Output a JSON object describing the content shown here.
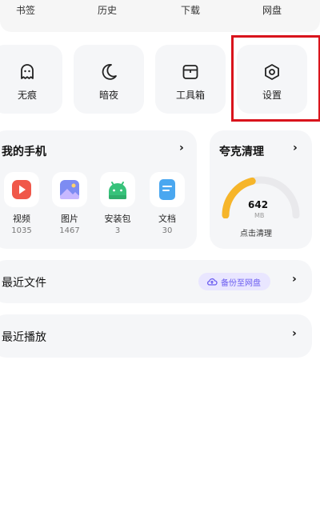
{
  "top_tabs": [
    "书签",
    "历史",
    "下载",
    "网盘"
  ],
  "quick_actions": [
    {
      "label": "无痕",
      "icon": "incognito-icon"
    },
    {
      "label": "暗夜",
      "icon": "moon-icon"
    },
    {
      "label": "工具箱",
      "icon": "toolbox-icon"
    },
    {
      "label": "设置",
      "icon": "gear-icon"
    }
  ],
  "my_phone": {
    "title": "我的手机",
    "items": [
      {
        "name": "视频",
        "count": "1035",
        "icon": "video-icon",
        "color": "#f0584a"
      },
      {
        "name": "图片",
        "count": "1467",
        "icon": "image-icon",
        "color": "#6b7cf0"
      },
      {
        "name": "安装包",
        "count": "3",
        "icon": "android-icon",
        "color": "#37c27a"
      },
      {
        "name": "文档",
        "count": "30",
        "icon": "document-icon",
        "color": "#4aa7f0"
      }
    ]
  },
  "cleaner": {
    "title": "夸克清理",
    "value": "642",
    "unit": "MB",
    "action": "点击清理",
    "fraction": 0.42,
    "accent": "#f6b52a"
  },
  "recent_files": {
    "title": "最近文件",
    "backup_label": "备份至网盘"
  },
  "recent_play": {
    "title": "最近播放"
  }
}
